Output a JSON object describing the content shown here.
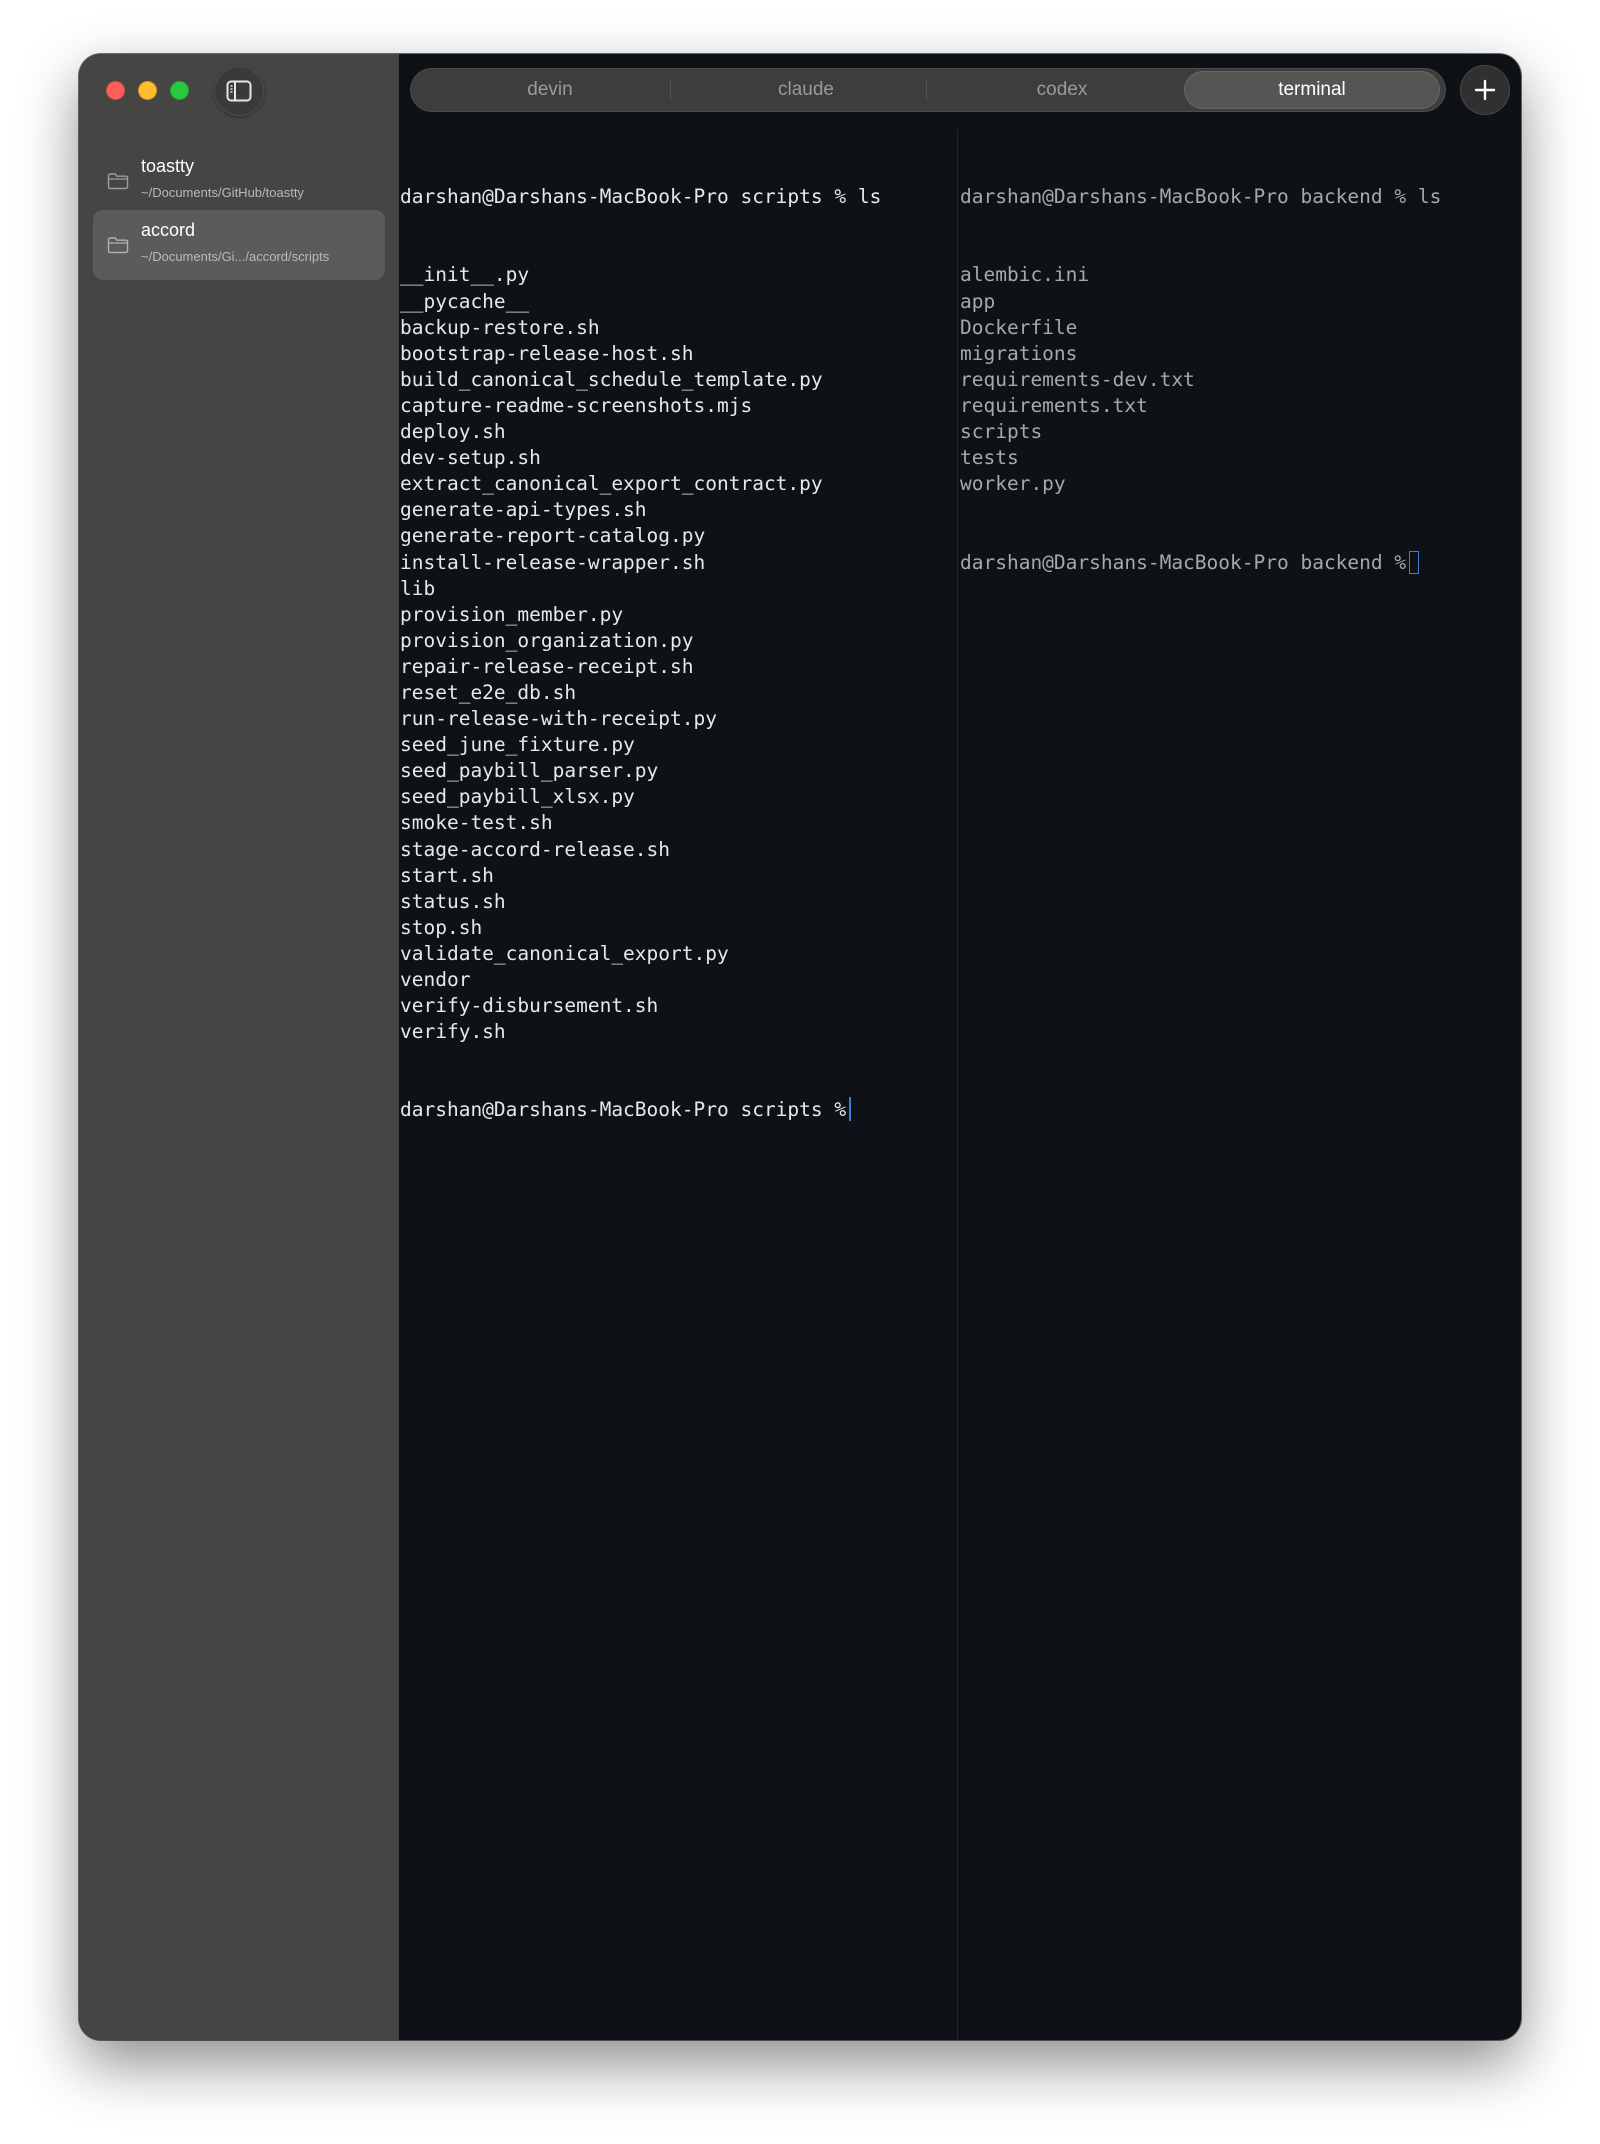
{
  "window": {
    "traffic_lights": [
      "close",
      "minimize",
      "zoom"
    ],
    "sidebar_toggle_icon": "sidebar-icon"
  },
  "sidebar": {
    "projects": [
      {
        "name": "toastty",
        "path": "~/Documents/GitHub/toastty",
        "icon": "folder-icon",
        "selected": false
      },
      {
        "name": "accord",
        "path": "~/Documents/Gi.../accord/scripts",
        "icon": "folder-icon",
        "selected": true
      }
    ]
  },
  "tabs": {
    "items": [
      {
        "label": "devin",
        "active": false
      },
      {
        "label": "claude",
        "active": false
      },
      {
        "label": "codex",
        "active": false
      },
      {
        "label": "terminal",
        "active": true
      }
    ],
    "add_icon": "plus-icon"
  },
  "terminal": {
    "left": {
      "command_line": "darshan@Darshans-MacBook-Pro scripts % ls",
      "output": [
        "__init__.py",
        "__pycache__",
        "backup-restore.sh",
        "bootstrap-release-host.sh",
        "build_canonical_schedule_template.py",
        "capture-readme-screenshots.mjs",
        "deploy.sh",
        "dev-setup.sh",
        "extract_canonical_export_contract.py",
        "generate-api-types.sh",
        "generate-report-catalog.py",
        "install-release-wrapper.sh",
        "lib",
        "provision_member.py",
        "provision_organization.py",
        "repair-release-receipt.sh",
        "reset_e2e_db.sh",
        "run-release-with-receipt.py",
        "seed_june_fixture.py",
        "seed_paybill_parser.py",
        "seed_paybill_xlsx.py",
        "smoke-test.sh",
        "stage-accord-release.sh",
        "start.sh",
        "status.sh",
        "stop.sh",
        "validate_canonical_export.py",
        "vendor",
        "verify-disbursement.sh",
        "verify.sh"
      ],
      "prompt": "darshan@Darshans-MacBook-Pro scripts %"
    },
    "right": {
      "command_line": "darshan@Darshans-MacBook-Pro backend % ls",
      "output": [
        "alembic.ini",
        "app",
        "Dockerfile",
        "migrations",
        "requirements-dev.txt",
        "requirements.txt",
        "scripts",
        "tests",
        "worker.py"
      ],
      "prompt": "darshan@Darshans-MacBook-Pro backend %"
    }
  },
  "colors": {
    "sidebar_bg": "#454644",
    "terminal_bg": "#0e1115",
    "cursor": "#3f7fd8",
    "active_text": "#e8e8e8",
    "inactive_text": "#a7a8a8"
  }
}
